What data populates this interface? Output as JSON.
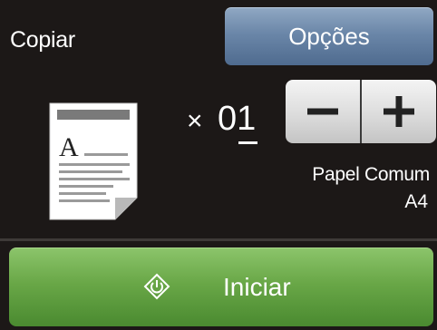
{
  "header": {
    "title": "Copiar",
    "options_label": "Opções"
  },
  "copies": {
    "multiplier": "×",
    "count": "01"
  },
  "paper": {
    "type": "Papel Comum",
    "size": "A4"
  },
  "document_icon": {
    "letter": "A"
  },
  "start": {
    "label": "Iniciar",
    "icon": "start-diamond-icon"
  },
  "stepper": {
    "minus_icon": "minus-icon",
    "plus_icon": "plus-icon"
  },
  "colors": {
    "background": "#1c1817",
    "options_button": "#6a86a8",
    "start_button": "#69a747",
    "stepper": "#dcdcdc"
  }
}
